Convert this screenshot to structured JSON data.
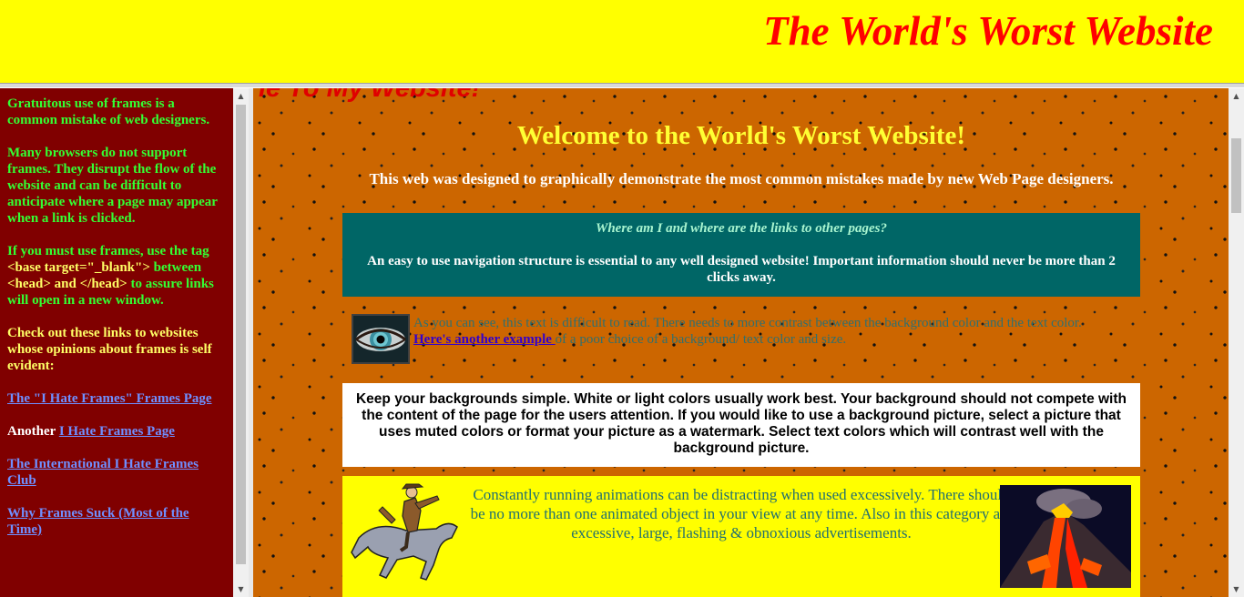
{
  "header": {
    "title": "The World's Worst Website"
  },
  "sidebar": {
    "para1": "Gratuitous use of frames is a common mistake of web designers.",
    "para2": "Many browsers do not support frames. They disrupt the flow of the website and can be difficult to anticipate where a page may appear when a link is clicked.",
    "para3_prefix": "If you must use frames, use the tag ",
    "para3_code": "<base target=\"_blank\">",
    "para3_mid": " between ",
    "para3_code2": "<head> and </head>",
    "para3_suffix": " to assure links will open in a new window.",
    "para4": "Check out these links to websites whose opinions about frames is self evident:",
    "link1": "The \"I Hate Frames\" Frames Page",
    "link2_prefix": "Another ",
    "link2": "I Hate Frames Page",
    "link3": "The International I Hate Frames Club",
    "link4": "Why Frames Suck (Most of the Time)"
  },
  "main": {
    "marquee": "le To My Website!",
    "welcome": "Welcome to the World's Worst Website!",
    "subtitle": "This web was designed to graphically demonstrate the most common mistakes made by new Web Page designers.",
    "nav_question": "Where am I and where are the links to other pages?",
    "nav_answer": "An easy to use navigation structure is essential to any well designed website! Important information should never be more than 2 clicks away.",
    "contrast_text": "As you can see, this text is difficult to read. There needs to more contrast between the background color and the text color.",
    "contrast_link": "Here's another example ",
    "contrast_suffix": "of a poor choice of a background/ text color and size.",
    "background_text": "Keep your backgrounds simple. White or light colors usually work best. Your background should not compete with the content of the page for the users attention. If you would like to use a background picture, select a picture that uses muted colors or format your picture as a watermark. Select text colors which will contrast well with the background picture.",
    "animation_text": "Constantly running animations can be distracting when used excessively. There should be no more than one animated object in your view at any time. Also in this category are excessive, large, flashing & obnoxious advertisements."
  },
  "icons": {
    "scroll_up": "scroll-up-arrow-icon",
    "scroll_down": "scroll-down-arrow-icon",
    "eye": "eye-image",
    "horse": "cowboy-horse-image",
    "volcano": "volcano-image"
  },
  "colors": {
    "header_bg": "#ffff00",
    "title": "#ff0000",
    "sidebar_bg": "#800000",
    "main_bg": "#cc6600",
    "teal_box": "#006666"
  }
}
